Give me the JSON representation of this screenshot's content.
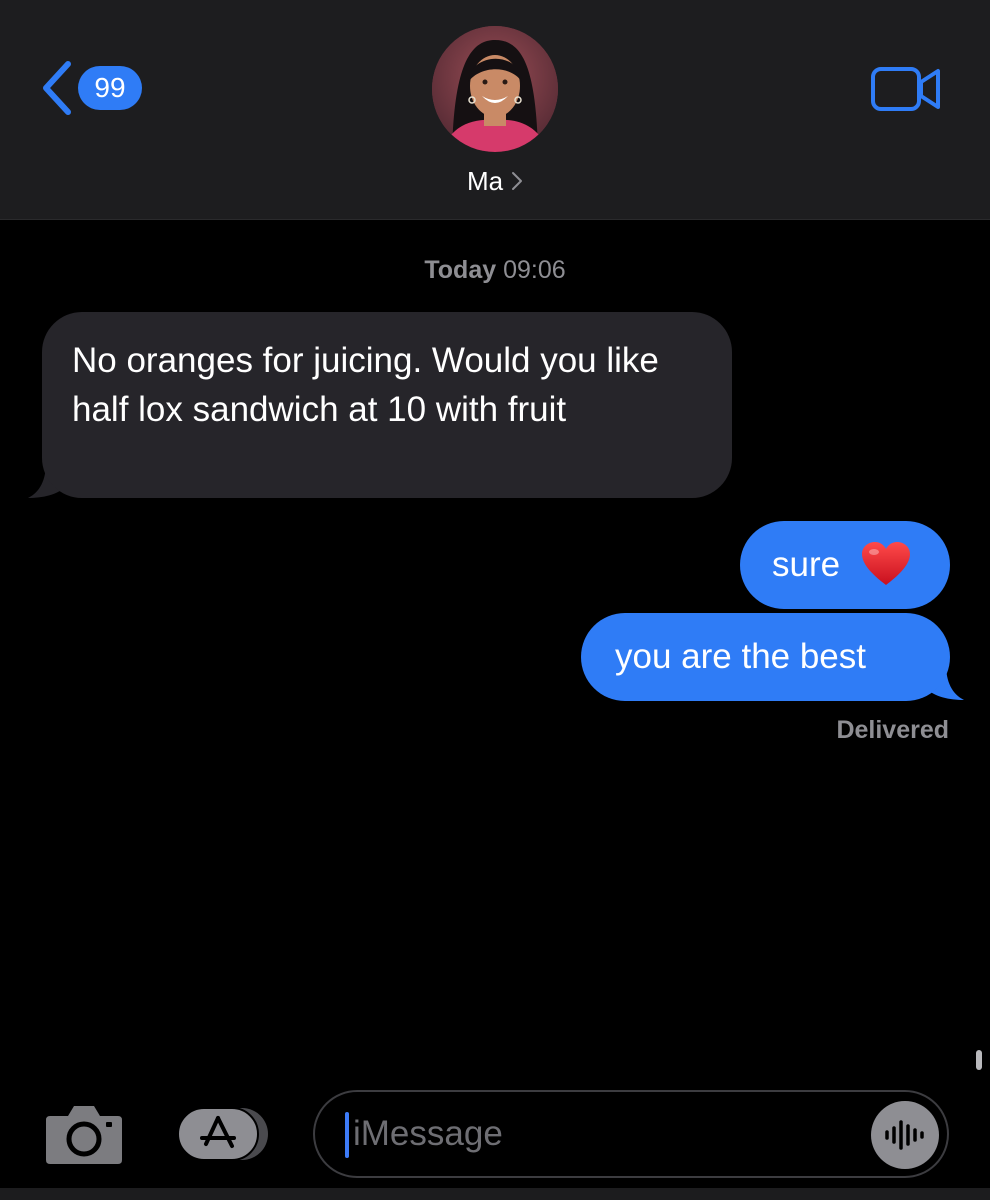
{
  "header": {
    "back_badge": "99",
    "contact_name": "Ma",
    "avatar_icon": "contact-photo",
    "video_icon": "video-camera-icon"
  },
  "conversation": {
    "timestamp_day": "Today",
    "timestamp_time": "09:06",
    "messages": [
      {
        "direction": "incoming",
        "text": "No oranges for juicing. Would you like half lox sandwich at 10 with fruit"
      },
      {
        "direction": "outgoing",
        "text": "sure",
        "emoji": "red-heart"
      },
      {
        "direction": "outgoing",
        "text": "you are the best"
      }
    ],
    "status": "Delivered"
  },
  "input_bar": {
    "placeholder": "iMessage",
    "camera_icon": "camera-icon",
    "apps_icon": "app-store-icon",
    "audio_icon": "audio-waveform-icon"
  },
  "colors": {
    "accent": "#2f7cf6",
    "incoming_bubble": "#26252a",
    "header_bg": "#1d1d1f",
    "muted_text": "#8e8e93",
    "heart": "#e0212f"
  }
}
